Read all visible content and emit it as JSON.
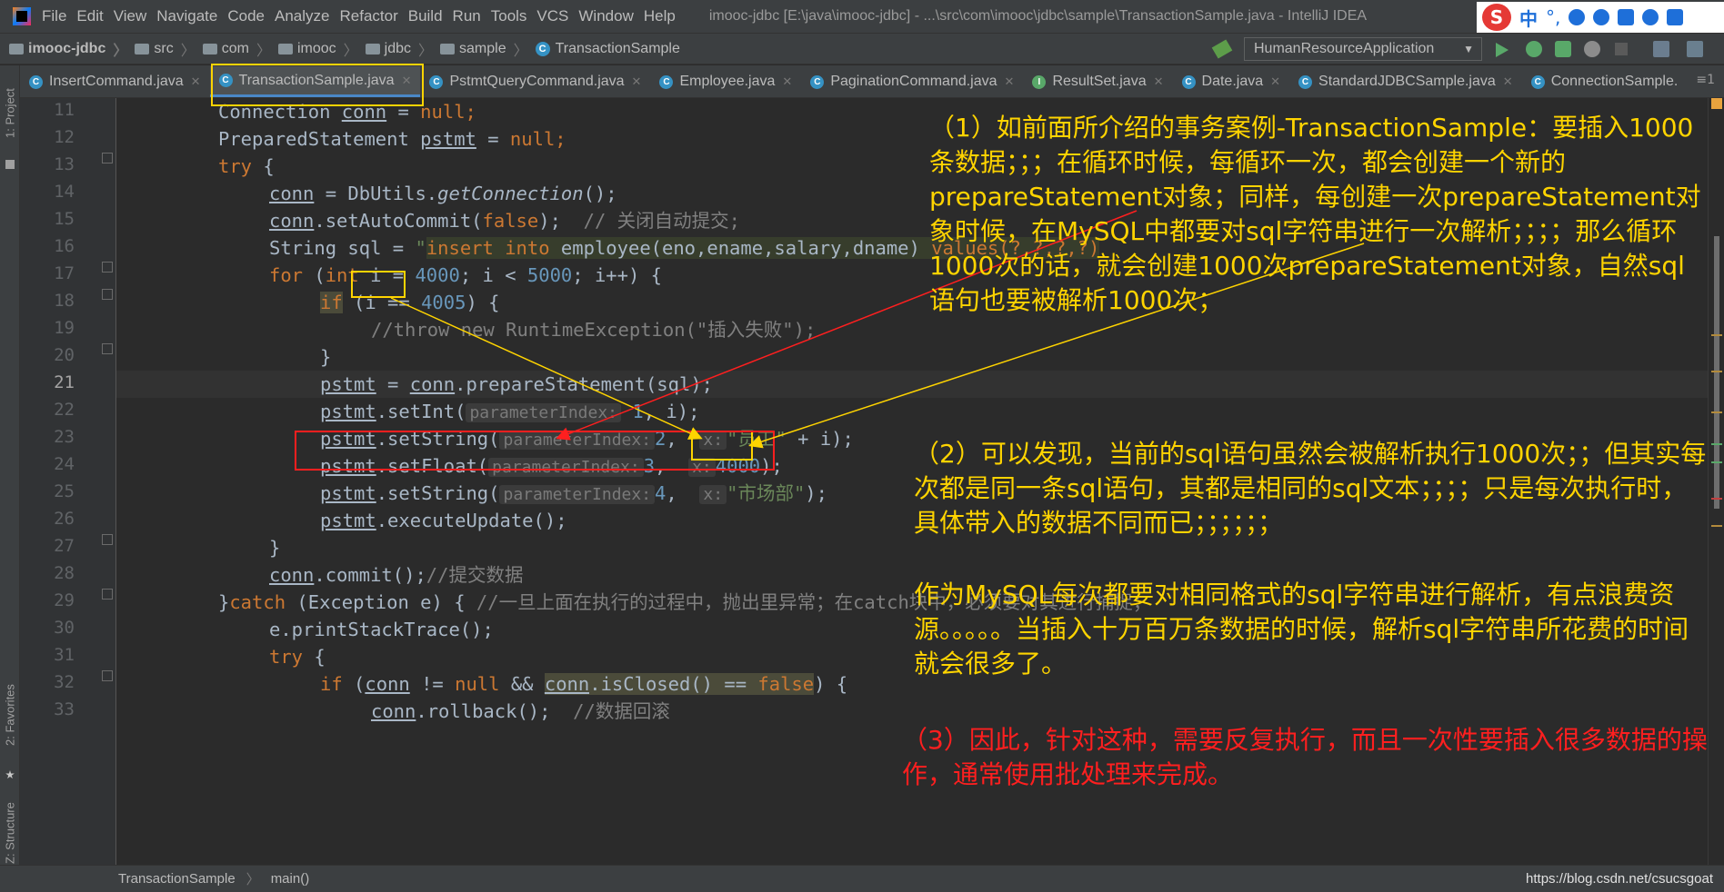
{
  "menubar": {
    "items": [
      "File",
      "Edit",
      "View",
      "Navigate",
      "Code",
      "Analyze",
      "Refactor",
      "Build",
      "Run",
      "Tools",
      "VCS",
      "Window",
      "Help"
    ],
    "title": "imooc-jdbc [E:\\java\\imooc-jdbc] - ...\\src\\com\\imooc\\jdbc\\sample\\TransactionSample.java - IntelliJ IDEA",
    "ime": {
      "logo": "S",
      "lang": "中"
    }
  },
  "navbar": {
    "crumbs": [
      "imooc-jdbc",
      "src",
      "com",
      "imooc",
      "jdbc",
      "sample",
      "TransactionSample"
    ],
    "run_config": "HumanResourceApplication"
  },
  "tabs": [
    {
      "label": "InsertCommand.java",
      "icon": "class-icon"
    },
    {
      "label": "TransactionSample.java",
      "icon": "class-icon",
      "active": true
    },
    {
      "label": "PstmtQueryCommand.java",
      "icon": "class-icon"
    },
    {
      "label": "Employee.java",
      "icon": "class-icon"
    },
    {
      "label": "PaginationCommand.java",
      "icon": "class-icon"
    },
    {
      "label": "ResultSet.java",
      "icon": "interface-icon"
    },
    {
      "label": "Date.java",
      "icon": "class-icon"
    },
    {
      "label": "StandardJDBCSample.java",
      "icon": "class-icon"
    },
    {
      "label": "ConnectionSample.",
      "icon": "class-icon"
    }
  ],
  "tab_more": "≡1",
  "left_stripe": {
    "project": "1: Project",
    "favorites": "2: Favorites",
    "structure": "Z: Structure"
  },
  "code": {
    "line_numbers": [
      "11",
      "12",
      "13",
      "14",
      "15",
      "16",
      "17",
      "18",
      "19",
      "20",
      "21",
      "22",
      "23",
      "24",
      "25",
      "26",
      "27",
      "28",
      "29",
      "30",
      "31",
      "32",
      "33"
    ],
    "current_line": "21",
    "tokens": {
      "l11a": "Connection ",
      "l11b": "conn",
      "l11c": " = ",
      "l11d": "null",
      "l11e": ";",
      "l12a": "PreparedStatement ",
      "l12b": "pstmt",
      "l12c": " = ",
      "l12d": "null",
      "l12e": ";",
      "l13a": "try",
      "l13b": " {",
      "l14a": "conn",
      "l14b": " = DbUtils.",
      "l14c": "getConnection",
      "l14d": "();",
      "l15a": "conn",
      "l15b": ".setAutoCommit(",
      "l15c": "false",
      "l15d": ");  ",
      "l15e": "// 关闭自动提交;",
      "l16a": "String ",
      "l16b": "sql",
      "l16c": " = ",
      "l16d": "\"",
      "l16e": "insert into",
      "l16f": " employee(eno,ename,salary,dname) ",
      "l16g": "values(?,?,?,?)",
      "l17a": "for",
      "l17b": " (",
      "l17c": "int",
      "l17d": " i = ",
      "l17e": "4000",
      "l17f": "; i < ",
      "l17g": "5000",
      "l17h": "; i++) {",
      "l18a": "if",
      "l18b": " (i == ",
      "l18c": "4005",
      "l18d": ") {",
      "l19a": "//throw new RuntimeException(\"插入失败\");",
      "l20a": "}",
      "l21a": "pstmt",
      "l21b": " = ",
      "l21c": "conn",
      "l21d": ".prepareStatement(",
      "l21e": "sql",
      "l21f": ");",
      "l22a": "pstmt",
      "l22b": ".setInt(",
      "l22c": "parameterIndex:",
      "l22d": " ",
      "l22e": "1",
      "l22f": ", i);",
      "l23a": "pstmt",
      "l23b": ".setString(",
      "l23c": "parameterIndex:",
      "l23d": "2",
      "l23e": ",  ",
      "l23f": "x:",
      "l23g": "\"员工\"",
      "l23h": " + i);",
      "l24a": "pstmt",
      "l24b": ".setFloat(",
      "l24c": "parameterIndex:",
      "l24d": "3",
      "l24e": ",  ",
      "l24f": "x:",
      "l24g": "4000",
      "l24h": ");",
      "l25a": "pstmt",
      "l25b": ".setString(",
      "l25c": "parameterIndex:",
      "l25d": "4",
      "l25e": ",  ",
      "l25f": "x:",
      "l25g": "\"市场部\"",
      "l25h": ");",
      "l26a": "pstmt",
      "l26b": ".executeUpdate();",
      "l27a": "}",
      "l28a": "conn",
      "l28b": ".commit();",
      "l28c": "//提交数据",
      "l29a": "}",
      "l29b": "catch",
      "l29c": " (Exception e) { ",
      "l29d": "//一旦上面在执行的过程中，抛出里异常；在catch块中，必须要对其进行捕捉；",
      "l30a": "e.printStackTrace();",
      "l31a": "try",
      "l31b": " {",
      "l32a": "if",
      "l32b": " (",
      "l32c": "conn",
      "l32d": " != ",
      "l32e": "null",
      "l32f": " && ",
      "l32g": "conn",
      "l32h": ".isClosed() == ",
      "l32i": "false",
      "l32j": ") {",
      "l33a": "conn",
      "l33b": ".rollback();  ",
      "l33c": "//数据回滚"
    }
  },
  "annotations": {
    "note1": "（1）如前面所介绍的事务案例-TransactionSample：要插入1000条数据；；；在循环时候，每循环一次，都会创建一个新的prepareStatement对象；同样，每创建一次prepareStatement对象时候，在MySQL中都要对sql字符串进行一次解析；；；；那么循环1000次的话，就会创建1000次prepareStatement对象，自然sql语句也要被解析1000次；",
    "note2": "（2）可以发现，当前的sql语句虽然会被解析执行1000次；；但其实每次都是同一条sql语句，其都是相同的sql文本；；；；只是每次执行时，具体带入的数据不同而已；；；；；；",
    "note3": "作为MySQL每次都要对相同格式的sql字符串进行解析，有点浪费资源。。。。。当插入十万百万条数据的时候，解析sql字符串所花费的时间就会很多了。",
    "note4": "（3）因此，针对这种，需要反复执行，而且一次性要插入很多数据的操作，通常使用批处理来完成。",
    "colors": {
      "yellow": "#ffd400",
      "red": "#ff1f1f"
    }
  },
  "statusbar": {
    "class": "TransactionSample",
    "method": "main()",
    "watermark": "https://blog.csdn.net/csucsgoat"
  }
}
